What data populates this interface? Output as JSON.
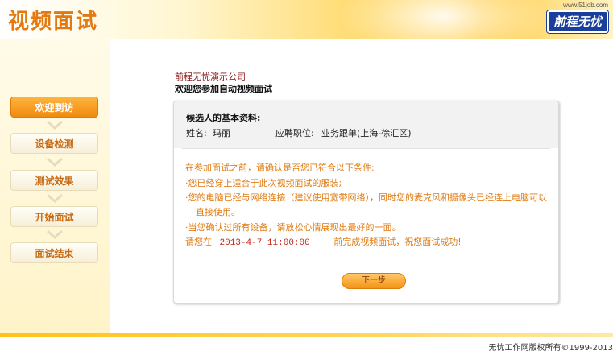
{
  "header": {
    "title": "视频面试",
    "logo_url": "www.51job.com",
    "logo_text": "前程无忧"
  },
  "sidebar": {
    "steps": [
      {
        "label": "欢迎到访",
        "active": true
      },
      {
        "label": "设备检测",
        "active": false
      },
      {
        "label": "测试效果",
        "active": false
      },
      {
        "label": "开始面试",
        "active": false
      },
      {
        "label": "面试结束",
        "active": false
      }
    ]
  },
  "main": {
    "company": "前程无忧演示公司",
    "welcome": "欢迎您参加自动视频面试",
    "info_title": "候选人的基本资料:",
    "name_label": "姓名:",
    "name_value": "玛丽",
    "position_label": "应聘职位:",
    "position_value": "业务跟单(上海-徐汇区)",
    "conditions_intro": "在参加面试之前，请确认是否您已符合以下条件:",
    "conditions": [
      "·您已经穿上适合于此次视频面试的服装;",
      "·您的电脑已经与网络连接（建议使用宽带网络），同时您的麦克风和摄像头已经连上电脑可以",
      "直接使用。",
      "·当您确认过所有设备，请放松心情展现出最好的一面。"
    ],
    "deadline_prefix": "请您在",
    "deadline_date": "2013-4-7 11:00:00",
    "deadline_suffix": "前完成视频面试，祝您面试成功!",
    "next_button": "下一步"
  },
  "footer": {
    "copyright": "无忧工作网版权所有©1999-2013"
  },
  "colors": {
    "accent_orange": "#f08a10",
    "title_orange": "#e27a10",
    "condition_orange": "#e07b12",
    "deadline_red": "#c0281c",
    "logo_blue": "#1a3f9a"
  }
}
